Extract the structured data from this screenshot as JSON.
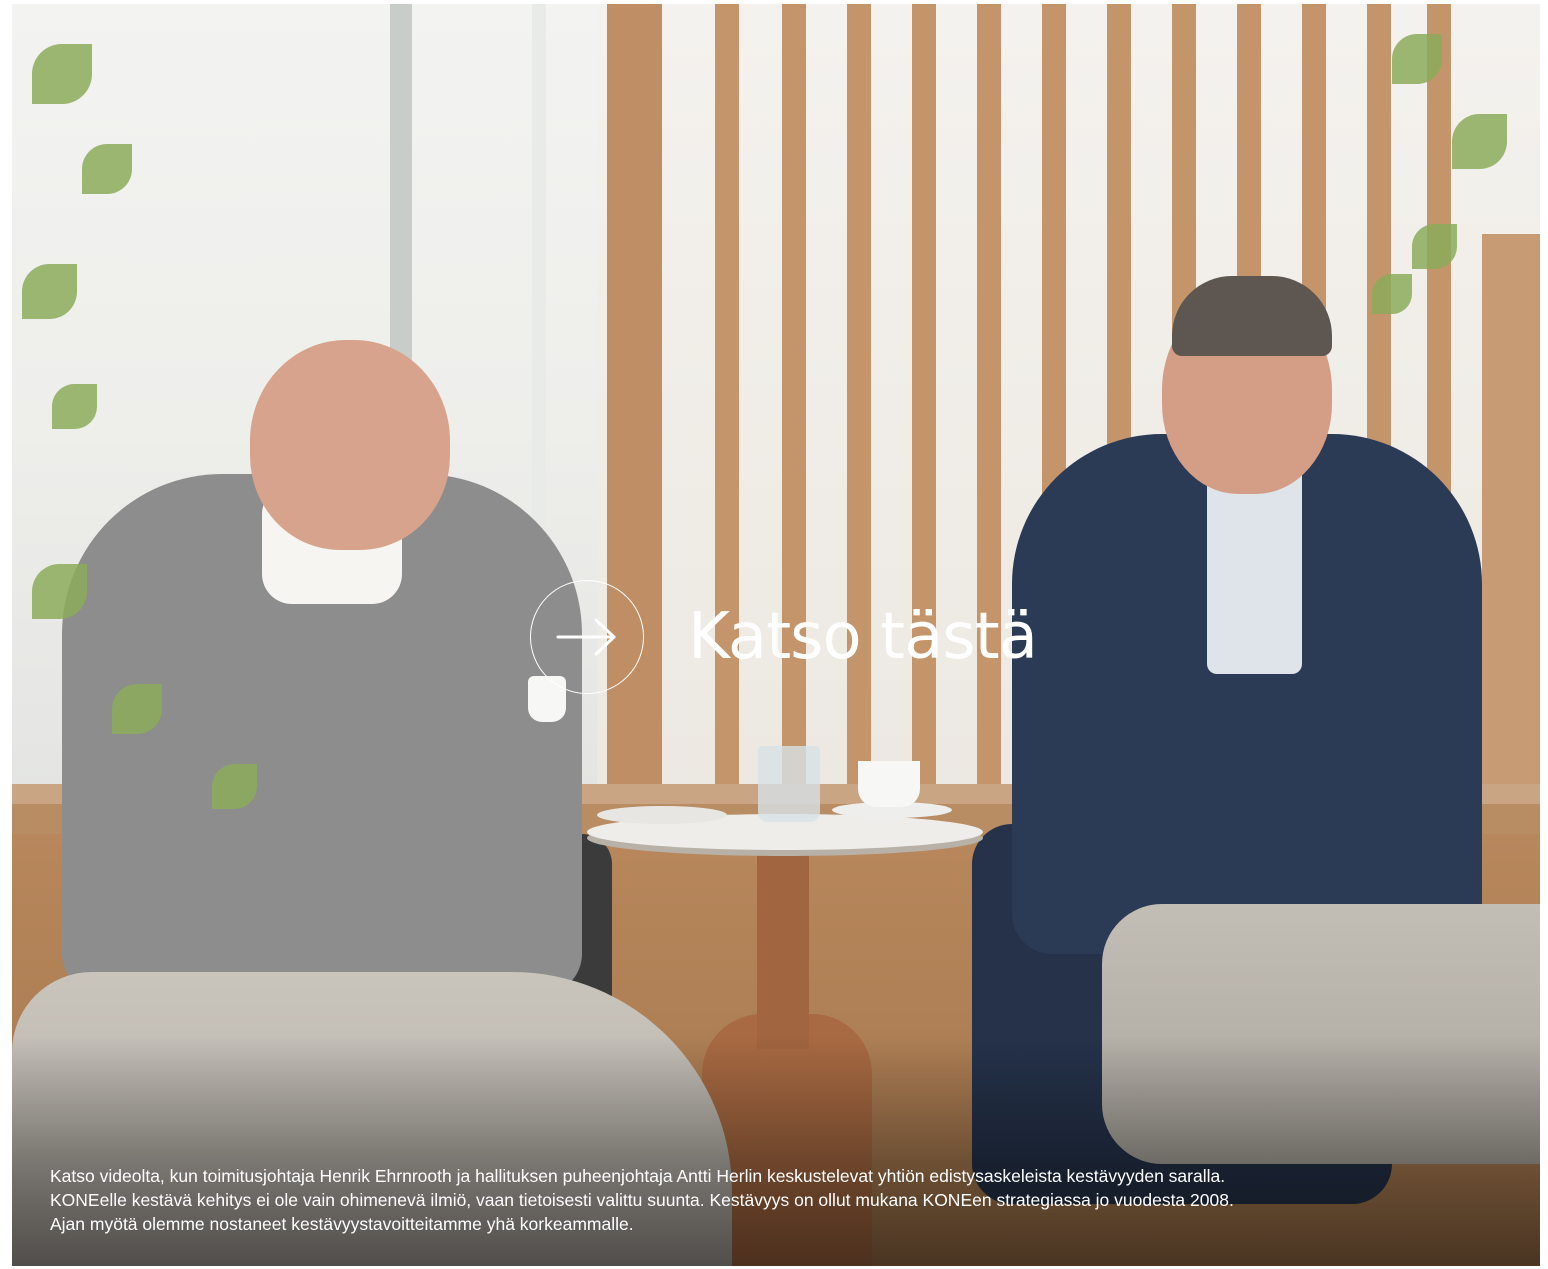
{
  "hero": {
    "image_alt_icon": "photo-two-people-conversation",
    "cta": {
      "icon": "arrow-right-icon",
      "label": "Katso tästä"
    },
    "caption_lines": [
      "Katso videolta, kun toimitusjohtaja Henrik Ehrnrooth ja hallituksen puheenjohtaja Antti Herlin keskustelevat yhtiön edistysaskeleista kestävyyden saralla.",
      "KONEelle kestävä kehitys ei ole vain ohimenevä ilmiö, vaan tietoisesti valittu suunta. Kestävyys on ollut mukana KONEen strategiassa jo vuodesta 2008.",
      "Ajan myötä olemme nostaneet kestävyystavoitteitamme yhä korkeammalle."
    ]
  },
  "colors": {
    "text_on_image": "#ffffff",
    "wood": "#a86a42",
    "suit_blue": "#2b3a55"
  }
}
